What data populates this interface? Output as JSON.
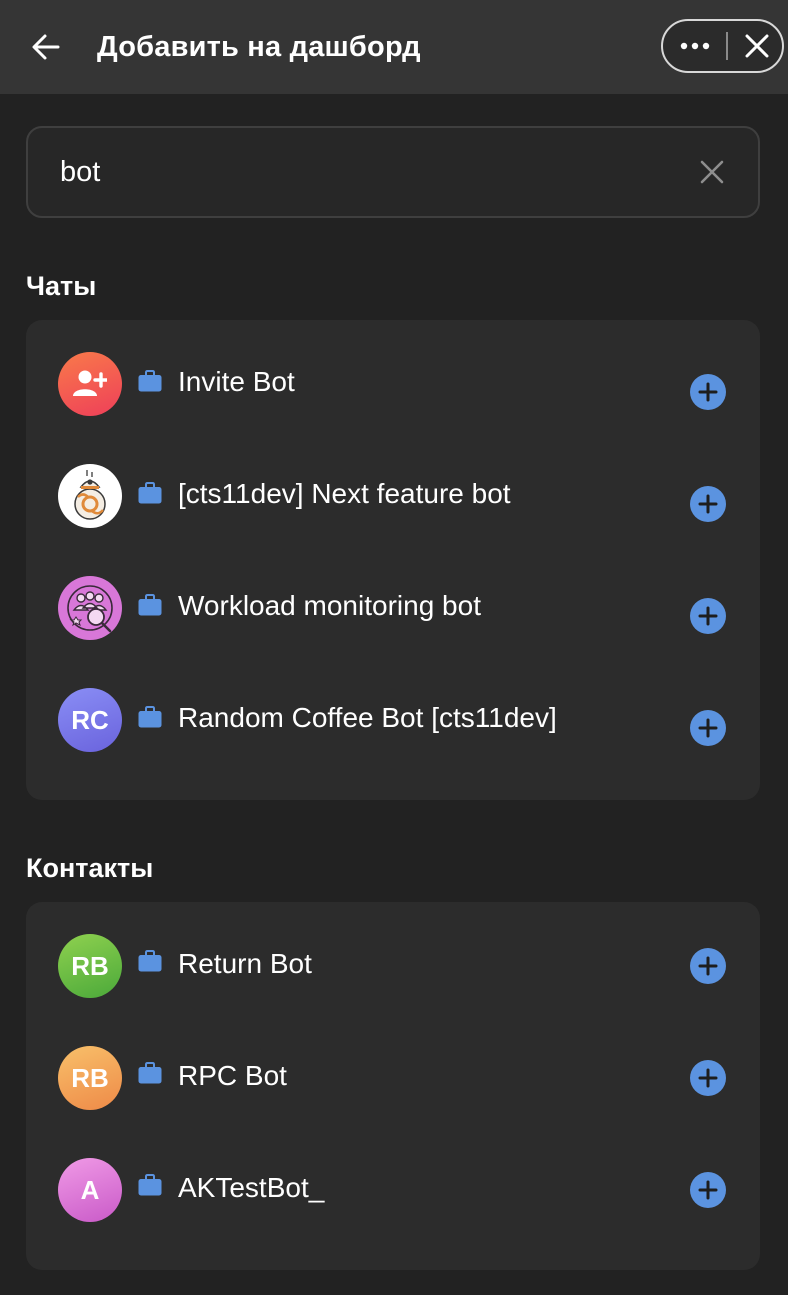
{
  "header": {
    "title": "Добавить на дашборд",
    "back_icon": "arrow-left-icon",
    "more_icon": "more-horizontal-icon",
    "close_icon": "close-icon"
  },
  "search": {
    "value": "bot",
    "clear_icon": "clear-icon"
  },
  "colors": {
    "accent": "#5b93e0",
    "background": "#222222",
    "header": "#353535",
    "card": "#2c2c2c"
  },
  "chats": {
    "title": "Чаты",
    "items": [
      {
        "label": "Invite Bot",
        "avatar": {
          "type": "icon",
          "icon": "user-plus-icon",
          "gradient": [
            "#f97a4a",
            "#ee3f59"
          ]
        },
        "badge_icon": "briefcase-icon",
        "action_icon": "plus-circle-icon"
      },
      {
        "label": "[cts11dev] Next feature bot",
        "avatar": {
          "type": "image",
          "icon": "bb8-robot-icon",
          "bg": "#ffffff"
        },
        "badge_icon": "briefcase-icon",
        "action_icon": "plus-circle-icon"
      },
      {
        "label": "Workload monitoring bot",
        "avatar": {
          "type": "image",
          "icon": "team-monitor-icon",
          "bg": "#d877d8"
        },
        "badge_icon": "briefcase-icon",
        "action_icon": "plus-circle-icon"
      },
      {
        "label": "Random Coffee Bot [cts11dev]",
        "avatar": {
          "type": "initials",
          "initials": "RC",
          "gradient": [
            "#8a8ef5",
            "#6a63dd"
          ]
        },
        "badge_icon": "briefcase-icon",
        "action_icon": "plus-circle-icon"
      }
    ]
  },
  "contacts": {
    "title": "Контакты",
    "items": [
      {
        "label": "Return Bot",
        "avatar": {
          "type": "initials",
          "initials": "RB",
          "gradient": [
            "#8fd14f",
            "#4ba93a"
          ]
        },
        "badge_icon": "briefcase-icon",
        "action_icon": "plus-circle-icon"
      },
      {
        "label": "RPC Bot",
        "avatar": {
          "type": "initials",
          "initials": "RB",
          "gradient": [
            "#f8c06a",
            "#ee8a48"
          ]
        },
        "badge_icon": "briefcase-icon",
        "action_icon": "plus-circle-icon"
      },
      {
        "label": "AKTestBot_",
        "avatar": {
          "type": "initials",
          "initials": "A",
          "gradient": [
            "#f09ae6",
            "#c95ac8"
          ]
        },
        "badge_icon": "briefcase-icon",
        "action_icon": "plus-circle-icon"
      }
    ]
  }
}
